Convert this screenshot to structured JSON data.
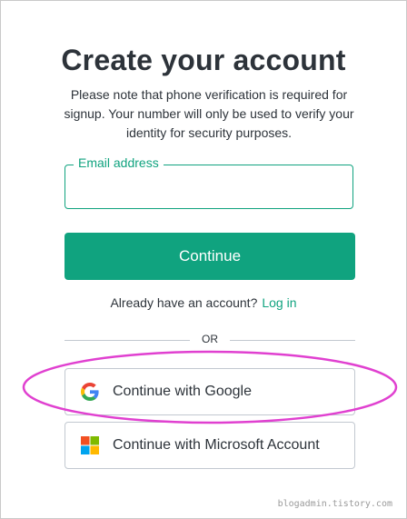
{
  "heading": "Create your account",
  "note": "Please note that phone verification is required for signup. Your number will only be used to verify your identity for security purposes.",
  "email": {
    "label": "Email address",
    "value": ""
  },
  "continue_label": "Continue",
  "login": {
    "prompt": "Already have an account?",
    "link": "Log in"
  },
  "divider_text": "OR",
  "social": {
    "google_label": "Continue with Google",
    "microsoft_label": "Continue with Microsoft Account"
  },
  "watermark": "blogadmin.tistory.com",
  "colors": {
    "accent": "#10a37f",
    "highlight": "#e040d0",
    "text": "#2d333a"
  }
}
